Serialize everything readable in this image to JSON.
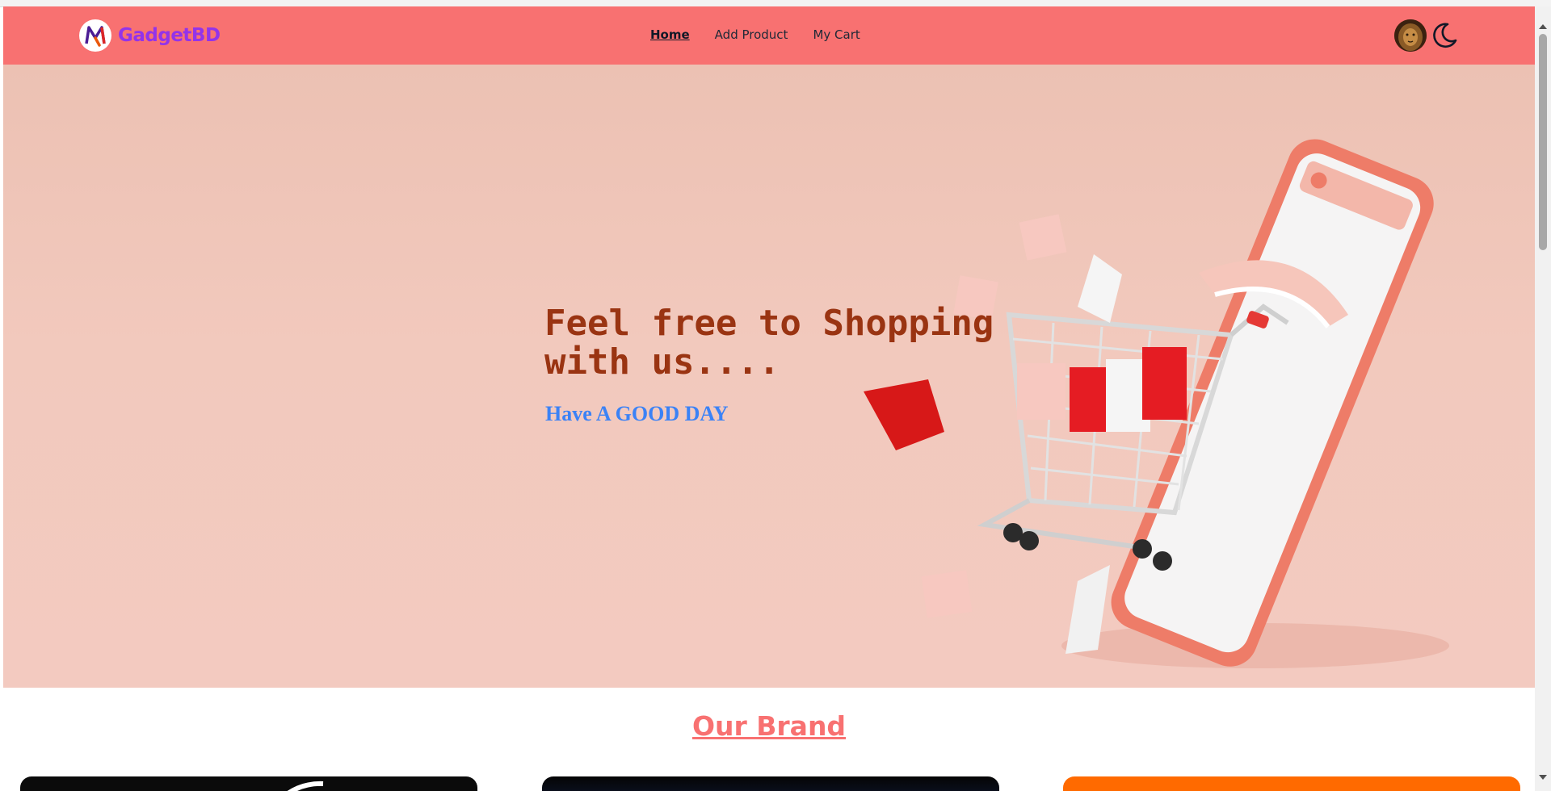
{
  "navbar": {
    "brand": "GadgetBD",
    "links": [
      {
        "label": "Home",
        "active": true
      },
      {
        "label": "Add Product",
        "active": false
      },
      {
        "label": "My Cart",
        "active": false
      }
    ]
  },
  "hero": {
    "title": "Feel free to Shopping with us....",
    "subtitle": "Have A GOOD DAY"
  },
  "brands": {
    "heading": "Our Brand"
  },
  "colors": {
    "navbar_bg": "#f87171",
    "brand_text": "#9333ea",
    "hero_title": "#9a3412",
    "hero_subtitle": "#3b82f6",
    "section_heading": "#f87171"
  }
}
